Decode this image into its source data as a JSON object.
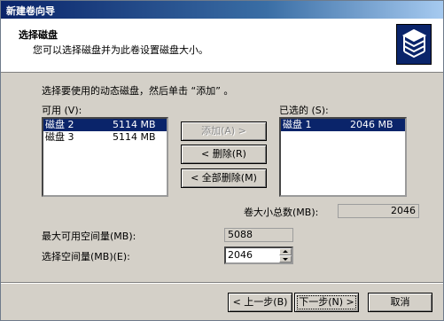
{
  "window": {
    "title": "新建卷向导"
  },
  "header": {
    "title": "选择磁盘",
    "subtitle": "您可以选择磁盘并为此卷设置磁盘大小。"
  },
  "instruction": "选择要使用的动态磁盘，然后单击 “添加” 。",
  "available": {
    "label": "可用 (V):",
    "items": [
      {
        "name": "磁盘 2",
        "size": "5114 MB",
        "selected": true
      },
      {
        "name": "磁盘 3",
        "size": "5114 MB",
        "selected": false
      }
    ]
  },
  "selected_list": {
    "label": "已选的 (S):",
    "items": [
      {
        "name": "磁盘 1",
        "size": "2046 MB",
        "selected": true
      }
    ]
  },
  "buttons": {
    "add": "添加(A) >",
    "remove": "< 删除(R)",
    "remove_all": "< 全部删除(M)",
    "back": "< 上一步(B)",
    "next": "下一步(N) >",
    "cancel": "取消"
  },
  "total_size": {
    "label": "卷大小总数(MB):",
    "value": "2046"
  },
  "max_space": {
    "label": "最大可用空间量(MB):",
    "value": "5088"
  },
  "select_space": {
    "label": "选择空间量(MB)(E):",
    "value": "2046"
  },
  "icons": {
    "logo": "disk-stack-icon",
    "spin_up": "up-arrow-icon",
    "spin_down": "down-arrow-icon"
  }
}
